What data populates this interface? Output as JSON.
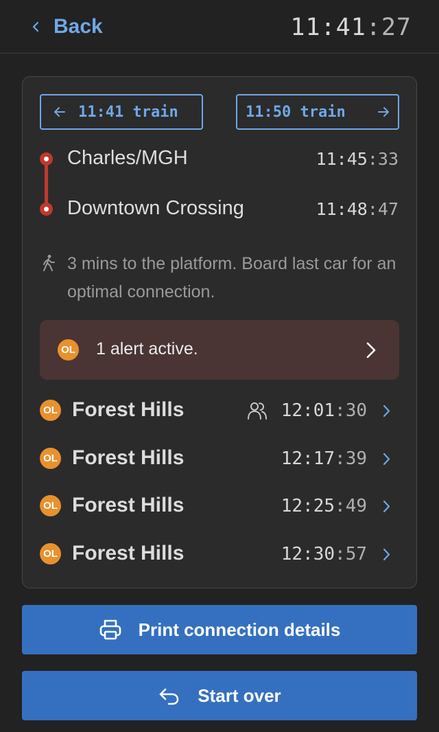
{
  "header": {
    "back_label": "Back",
    "clock_hm": "11:41",
    "clock_sep": ":",
    "clock_s": "27"
  },
  "trip": {
    "prev_train_label": "11:41 train",
    "next_train_label": "11:50 train",
    "line_color": "#c0392b",
    "stops": [
      {
        "name": "Charles/MGH",
        "time_hm": "11:45",
        "time_s": "33"
      },
      {
        "name": "Downtown Crossing",
        "time_hm": "11:48",
        "time_s": "47"
      }
    ],
    "walk_note": "3 mins to the platform. Board last car for an optimal connection."
  },
  "alert": {
    "line_badge": "OL",
    "text": "1 alert active."
  },
  "departures": [
    {
      "badge": "OL",
      "destination": "Forest Hills",
      "time_hm": "12:01",
      "time_s": "30",
      "crowding_icon": "people-icon"
    },
    {
      "badge": "OL",
      "destination": "Forest Hills",
      "time_hm": "12:17",
      "time_s": "39"
    },
    {
      "badge": "OL",
      "destination": "Forest Hills",
      "time_hm": "12:25",
      "time_s": "49"
    },
    {
      "badge": "OL",
      "destination": "Forest Hills",
      "time_hm": "12:30",
      "time_s": "57"
    }
  ],
  "actions": {
    "print_label": "Print connection details",
    "start_over_label": "Start over"
  },
  "colors": {
    "accent": "#6ea8e8",
    "button": "#3570c0",
    "orange_line": "#e8912d",
    "alert_bg": "#4a3434"
  }
}
